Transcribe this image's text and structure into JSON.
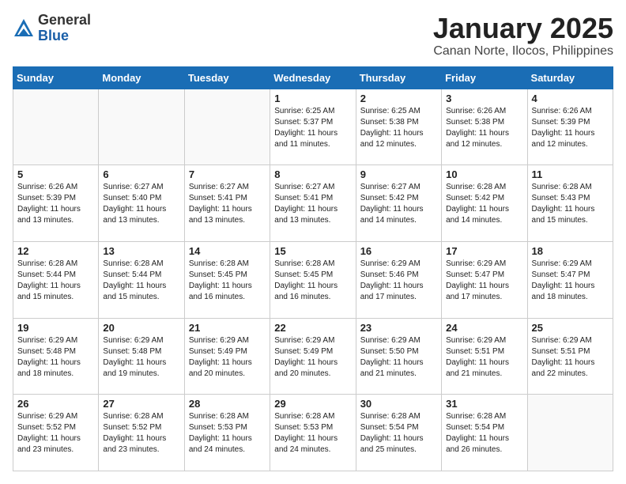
{
  "header": {
    "logo_general": "General",
    "logo_blue": "Blue",
    "title": "January 2025",
    "location": "Canan Norte, Ilocos, Philippines"
  },
  "days_of_week": [
    "Sunday",
    "Monday",
    "Tuesday",
    "Wednesday",
    "Thursday",
    "Friday",
    "Saturday"
  ],
  "weeks": [
    [
      {
        "num": "",
        "info": ""
      },
      {
        "num": "",
        "info": ""
      },
      {
        "num": "",
        "info": ""
      },
      {
        "num": "1",
        "info": "Sunrise: 6:25 AM\nSunset: 5:37 PM\nDaylight: 11 hours\nand 11 minutes."
      },
      {
        "num": "2",
        "info": "Sunrise: 6:25 AM\nSunset: 5:38 PM\nDaylight: 11 hours\nand 12 minutes."
      },
      {
        "num": "3",
        "info": "Sunrise: 6:26 AM\nSunset: 5:38 PM\nDaylight: 11 hours\nand 12 minutes."
      },
      {
        "num": "4",
        "info": "Sunrise: 6:26 AM\nSunset: 5:39 PM\nDaylight: 11 hours\nand 12 minutes."
      }
    ],
    [
      {
        "num": "5",
        "info": "Sunrise: 6:26 AM\nSunset: 5:39 PM\nDaylight: 11 hours\nand 13 minutes."
      },
      {
        "num": "6",
        "info": "Sunrise: 6:27 AM\nSunset: 5:40 PM\nDaylight: 11 hours\nand 13 minutes."
      },
      {
        "num": "7",
        "info": "Sunrise: 6:27 AM\nSunset: 5:41 PM\nDaylight: 11 hours\nand 13 minutes."
      },
      {
        "num": "8",
        "info": "Sunrise: 6:27 AM\nSunset: 5:41 PM\nDaylight: 11 hours\nand 13 minutes."
      },
      {
        "num": "9",
        "info": "Sunrise: 6:27 AM\nSunset: 5:42 PM\nDaylight: 11 hours\nand 14 minutes."
      },
      {
        "num": "10",
        "info": "Sunrise: 6:28 AM\nSunset: 5:42 PM\nDaylight: 11 hours\nand 14 minutes."
      },
      {
        "num": "11",
        "info": "Sunrise: 6:28 AM\nSunset: 5:43 PM\nDaylight: 11 hours\nand 15 minutes."
      }
    ],
    [
      {
        "num": "12",
        "info": "Sunrise: 6:28 AM\nSunset: 5:44 PM\nDaylight: 11 hours\nand 15 minutes."
      },
      {
        "num": "13",
        "info": "Sunrise: 6:28 AM\nSunset: 5:44 PM\nDaylight: 11 hours\nand 15 minutes."
      },
      {
        "num": "14",
        "info": "Sunrise: 6:28 AM\nSunset: 5:45 PM\nDaylight: 11 hours\nand 16 minutes."
      },
      {
        "num": "15",
        "info": "Sunrise: 6:28 AM\nSunset: 5:45 PM\nDaylight: 11 hours\nand 16 minutes."
      },
      {
        "num": "16",
        "info": "Sunrise: 6:29 AM\nSunset: 5:46 PM\nDaylight: 11 hours\nand 17 minutes."
      },
      {
        "num": "17",
        "info": "Sunrise: 6:29 AM\nSunset: 5:47 PM\nDaylight: 11 hours\nand 17 minutes."
      },
      {
        "num": "18",
        "info": "Sunrise: 6:29 AM\nSunset: 5:47 PM\nDaylight: 11 hours\nand 18 minutes."
      }
    ],
    [
      {
        "num": "19",
        "info": "Sunrise: 6:29 AM\nSunset: 5:48 PM\nDaylight: 11 hours\nand 18 minutes."
      },
      {
        "num": "20",
        "info": "Sunrise: 6:29 AM\nSunset: 5:48 PM\nDaylight: 11 hours\nand 19 minutes."
      },
      {
        "num": "21",
        "info": "Sunrise: 6:29 AM\nSunset: 5:49 PM\nDaylight: 11 hours\nand 20 minutes."
      },
      {
        "num": "22",
        "info": "Sunrise: 6:29 AM\nSunset: 5:49 PM\nDaylight: 11 hours\nand 20 minutes."
      },
      {
        "num": "23",
        "info": "Sunrise: 6:29 AM\nSunset: 5:50 PM\nDaylight: 11 hours\nand 21 minutes."
      },
      {
        "num": "24",
        "info": "Sunrise: 6:29 AM\nSunset: 5:51 PM\nDaylight: 11 hours\nand 21 minutes."
      },
      {
        "num": "25",
        "info": "Sunrise: 6:29 AM\nSunset: 5:51 PM\nDaylight: 11 hours\nand 22 minutes."
      }
    ],
    [
      {
        "num": "26",
        "info": "Sunrise: 6:29 AM\nSunset: 5:52 PM\nDaylight: 11 hours\nand 23 minutes."
      },
      {
        "num": "27",
        "info": "Sunrise: 6:28 AM\nSunset: 5:52 PM\nDaylight: 11 hours\nand 23 minutes."
      },
      {
        "num": "28",
        "info": "Sunrise: 6:28 AM\nSunset: 5:53 PM\nDaylight: 11 hours\nand 24 minutes."
      },
      {
        "num": "29",
        "info": "Sunrise: 6:28 AM\nSunset: 5:53 PM\nDaylight: 11 hours\nand 24 minutes."
      },
      {
        "num": "30",
        "info": "Sunrise: 6:28 AM\nSunset: 5:54 PM\nDaylight: 11 hours\nand 25 minutes."
      },
      {
        "num": "31",
        "info": "Sunrise: 6:28 AM\nSunset: 5:54 PM\nDaylight: 11 hours\nand 26 minutes."
      },
      {
        "num": "",
        "info": ""
      }
    ]
  ]
}
